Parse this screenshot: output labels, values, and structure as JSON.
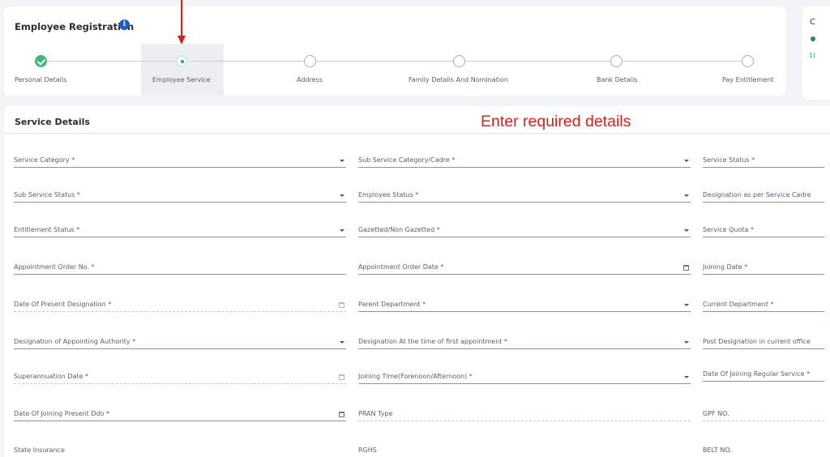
{
  "header": {
    "title": "Employee Registration",
    "info_icon": "info-icon"
  },
  "stepper": {
    "steps": [
      {
        "label": "Personal Details",
        "state": "done"
      },
      {
        "label": "Employee Service",
        "state": "active"
      },
      {
        "label": "Address",
        "state": "pending"
      },
      {
        "label": "Family Details And Nomination",
        "state": "pending"
      },
      {
        "label": "Bank Details",
        "state": "pending"
      },
      {
        "label": "Pay Entitlement",
        "state": "pending"
      }
    ]
  },
  "side_panel": {
    "letter": "C",
    "number": "1("
  },
  "annotation": {
    "text": "Enter required details",
    "color": "#d9211e"
  },
  "service": {
    "section_title": "Service Details",
    "fields": [
      {
        "label": "Service Category *",
        "control": "select"
      },
      {
        "label": "Sub Service Category/Cadre *",
        "control": "select"
      },
      {
        "label": "Service Status *",
        "control": "select"
      },
      {
        "label": "Sub Service Status *",
        "control": "select"
      },
      {
        "label": "Employee Status *",
        "control": "select"
      },
      {
        "label": "Designation as per Service Cadre",
        "control": "select"
      },
      {
        "label": "Entitlement Status *",
        "control": "select"
      },
      {
        "label": "Gazetted/Non Gazetted *",
        "control": "select"
      },
      {
        "label": "Service Quota *",
        "control": "select"
      },
      {
        "label": "Appointment Order No. *",
        "control": "text"
      },
      {
        "label": "Appointment Order Date *",
        "control": "date"
      },
      {
        "label": "Joining Date *",
        "control": "date"
      },
      {
        "label": "Date Of Present Designation *",
        "control": "date-disabled"
      },
      {
        "label": "Parent Department *",
        "control": "select"
      },
      {
        "label": "Current Department *",
        "control": "select"
      },
      {
        "label": "Designation of Appointing Authority *",
        "control": "select"
      },
      {
        "label": "Designation At the time of first appointment *",
        "control": "select"
      },
      {
        "label": "Post Designation in current office",
        "control": "select"
      },
      {
        "label": "Superannuation Date *",
        "control": "date-disabled"
      },
      {
        "label": "Joining Time(Forenoon/Afternoon) *",
        "control": "select"
      },
      {
        "label": "Date Of Joining Regular Service *",
        "control": "date"
      },
      {
        "label": "Date Of Joining Present Ddo *",
        "control": "date"
      },
      {
        "label": "PRAN Type",
        "control": "readonly"
      },
      {
        "label": "GPF NO.",
        "control": "readonly"
      },
      {
        "label": "State Insurance",
        "control": "readonly"
      },
      {
        "label": "RGHS",
        "control": "readonly"
      },
      {
        "label": "BELT NO.",
        "control": "readonly"
      }
    ]
  }
}
